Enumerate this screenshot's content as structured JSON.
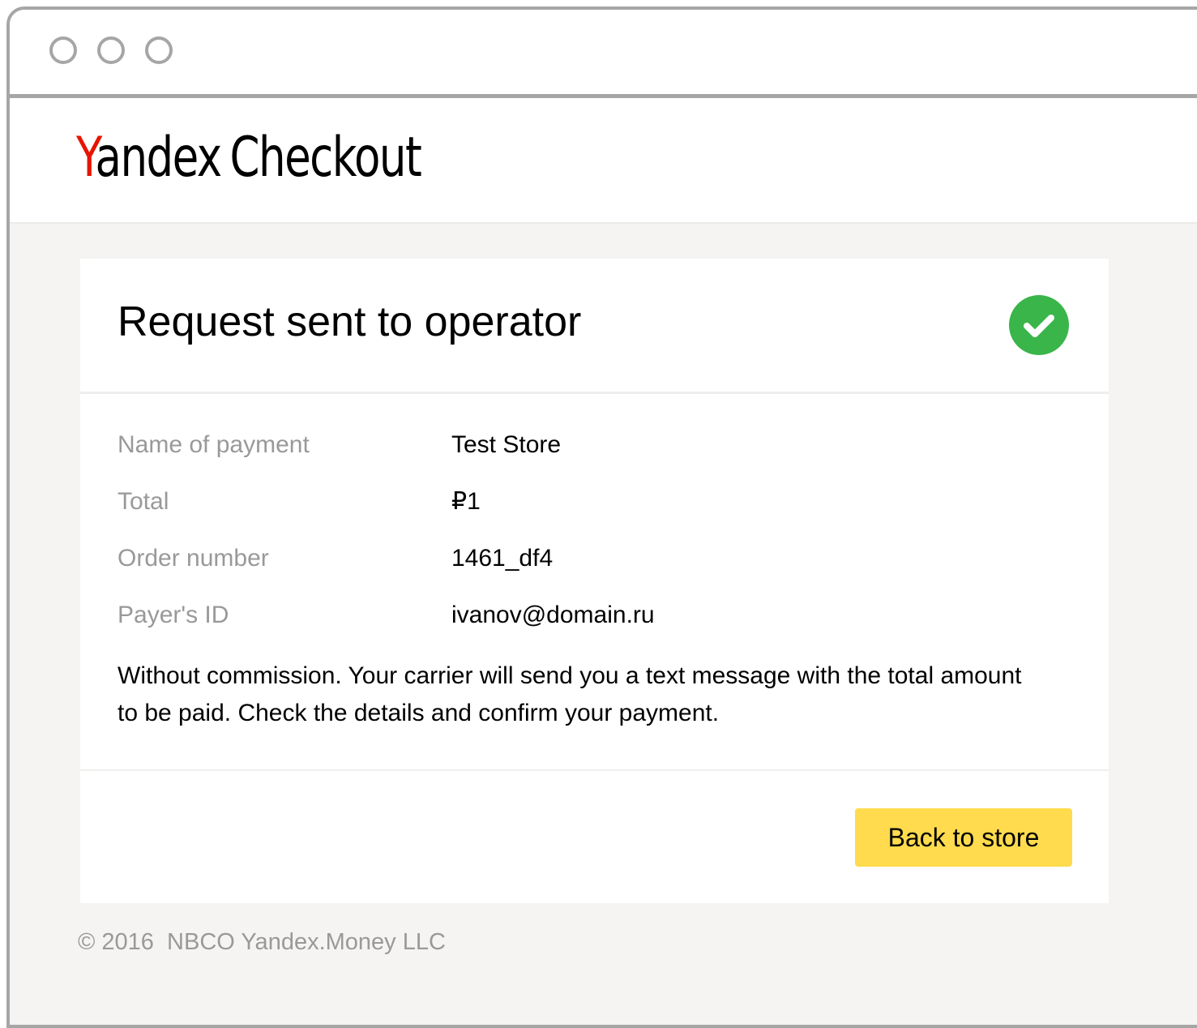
{
  "window": {
    "controls": [
      "window-dot",
      "window-dot",
      "window-dot"
    ]
  },
  "header": {
    "logo_brand_first_letter": "Y",
    "logo_brand_rest": "andex",
    "logo_product": "Checkout",
    "brand_color": "#e61400"
  },
  "card": {
    "title": "Request sent to operator",
    "status_icon": "check-circle-icon",
    "status_color": "#39b54a",
    "rows": [
      {
        "label": "Name of payment",
        "value": "Test Store"
      },
      {
        "label": "Total",
        "value": "₽1"
      },
      {
        "label": "Order number",
        "value": "1461_df4"
      },
      {
        "label": "Payer's ID",
        "value": "ivanov@domain.ru"
      }
    ],
    "note": "Without commission. Your carrier will send you a text message with the total amount to be paid. Check the details and confirm your payment.",
    "back_button_label": "Back to store",
    "button_color": "#ffdb4d"
  },
  "footer": {
    "copyright": "© 2016  NBCO Yandex.Money LLC"
  }
}
